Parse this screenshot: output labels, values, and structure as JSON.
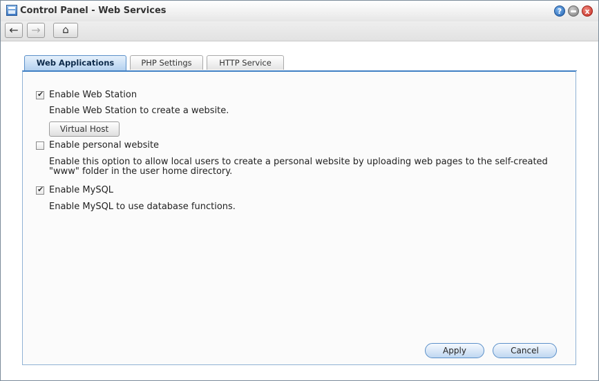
{
  "window": {
    "title": "Control Panel - Web Services",
    "controls": {
      "help": "?",
      "minimize": "",
      "close": "x"
    }
  },
  "toolbar": {
    "back_icon": "←",
    "forward_icon": "→",
    "home_icon": "⌂"
  },
  "tabs": [
    {
      "label": "Web Applications",
      "active": true
    },
    {
      "label": "PHP Settings",
      "active": false
    },
    {
      "label": "HTTP Service",
      "active": false
    }
  ],
  "options": [
    {
      "label": "Enable Web Station",
      "checked": true,
      "description": "Enable Web Station to create a website."
    },
    {
      "label": "Enable personal website",
      "checked": false,
      "description_line1": "Enable this option to allow local users to create a personal website by uploading web pages to the self-created",
      "description_line2": "\"www\" folder in the user home directory."
    },
    {
      "label": "Enable MySQL",
      "checked": true,
      "description": "Enable MySQL to use database functions."
    }
  ],
  "virtual_host_button": "Virtual Host",
  "footer": {
    "apply": "Apply",
    "cancel": "Cancel"
  }
}
